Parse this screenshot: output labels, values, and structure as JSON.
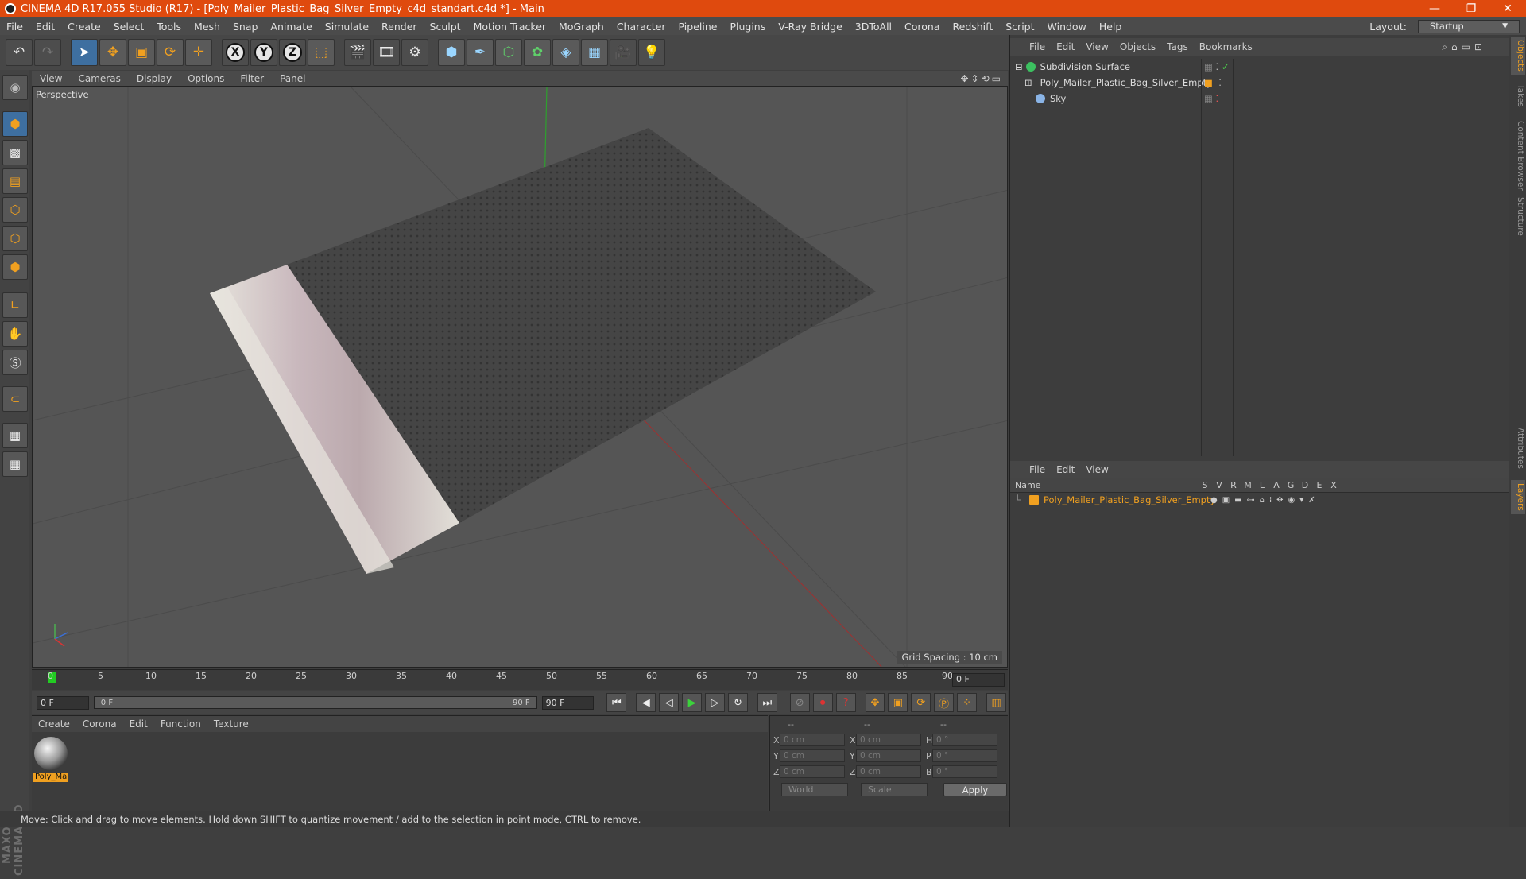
{
  "window": {
    "title": "CINEMA 4D R17.055 Studio (R17) - [Poly_Mailer_Plastic_Bag_Silver_Empty_c4d_standart.c4d *] - Main",
    "controls": [
      "—",
      "❐",
      "✕"
    ]
  },
  "menu": {
    "items": [
      "File",
      "Edit",
      "Create",
      "Select",
      "Tools",
      "Mesh",
      "Snap",
      "Animate",
      "Simulate",
      "Render",
      "Sculpt",
      "Motion Tracker",
      "MoGraph",
      "Character",
      "Pipeline",
      "Plugins",
      "V-Ray Bridge",
      "3DToAll",
      "Corona",
      "Redshift",
      "Script",
      "Window",
      "Help"
    ],
    "layout_label": "Layout:",
    "layout_value": "Startup"
  },
  "toolbar": {
    "icons": [
      "undo-icon",
      "redo-icon",
      "select-arrow-icon",
      "move-icon",
      "scale-icon",
      "rotate-icon",
      "live-select-icon",
      "x-axis-icon",
      "y-axis-icon",
      "z-axis-icon",
      "world-coords-icon",
      "render-view-icon",
      "render-picture-viewer-icon",
      "render-settings-icon",
      "cube-icon",
      "pen-icon",
      "subdivision-icon",
      "array-icon",
      "deformer-icon",
      "floor-icon",
      "camera-icon",
      "light-icon"
    ],
    "axis_letters": [
      "X",
      "Y",
      "Z"
    ]
  },
  "viewport": {
    "menu": [
      "View",
      "Cameras",
      "Display",
      "Options",
      "Filter",
      "Panel"
    ],
    "label": "Perspective",
    "grid_spacing": "Grid Spacing : 10 cm"
  },
  "timeline": {
    "ticks": [
      "0",
      "5",
      "10",
      "15",
      "20",
      "25",
      "30",
      "35",
      "40",
      "45",
      "50",
      "55",
      "60",
      "65",
      "70",
      "75",
      "80",
      "85",
      "90"
    ],
    "current_frame": "0 F",
    "start_field": "0 F",
    "range_start": "0 F",
    "range_end": "90 F",
    "end_field": "90 F"
  },
  "materials": {
    "menu": [
      "Create",
      "Corona",
      "Edit",
      "Function",
      "Texture"
    ],
    "items": [
      {
        "name": "Poly_Ma"
      }
    ]
  },
  "coordinates": {
    "headers": [
      "--",
      "--",
      "--"
    ],
    "rows": [
      {
        "l1": "X",
        "v1": "0 cm",
        "l2": "X",
        "v2": "0 cm",
        "l3": "H",
        "v3": "0 °"
      },
      {
        "l1": "Y",
        "v1": "0 cm",
        "l2": "Y",
        "v2": "0 cm",
        "l3": "P",
        "v3": "0 °"
      },
      {
        "l1": "Z",
        "v1": "0 cm",
        "l2": "Z",
        "v2": "0 cm",
        "l3": "B",
        "v3": "0 °"
      }
    ],
    "space": "World",
    "mode": "Scale",
    "apply": "Apply"
  },
  "status": "Move: Click and drag to move elements. Hold down SHIFT to quantize movement / add to the selection in point mode, CTRL to remove.",
  "objects": {
    "menu": [
      "File",
      "Edit",
      "View",
      "Objects",
      "Tags",
      "Bookmarks"
    ],
    "rows": [
      {
        "name": "Subdivision Surface",
        "icon_color": "#3cc060"
      },
      {
        "name": "Poly_Mailer_Plastic_Bag_Silver_Empty",
        "icon_color": "#cfcfcf"
      },
      {
        "name": "Sky",
        "icon_color": "#8ab4e6"
      }
    ]
  },
  "layers": {
    "menu": [
      "File",
      "Edit",
      "View"
    ],
    "columns": [
      "Name",
      "S",
      "V",
      "R",
      "M",
      "L",
      "A",
      "G",
      "D",
      "E",
      "X"
    ],
    "rows": [
      {
        "name": "Poly_Mailer_Plastic_Bag_Silver_Empty",
        "color": "#f0a020"
      }
    ]
  },
  "side_tabs": [
    "Objects",
    "Takes",
    "Content Browser",
    "Structure",
    "Attributes",
    "Layers"
  ],
  "colors": {
    "title_bar": "#df4a0e",
    "accent": "#f0a020",
    "selection": "#3e6fa0"
  }
}
